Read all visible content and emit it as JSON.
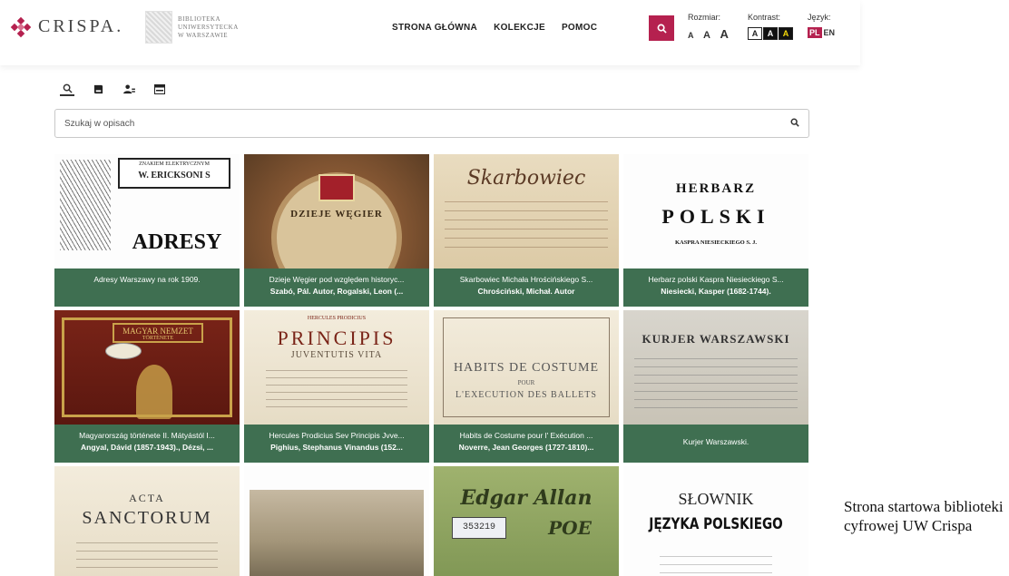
{
  "header": {
    "logo_text": "CRISPA.",
    "uw_logo_lines": [
      "BIBLIOTEKA",
      "UNIWERSYTECKA",
      "W WARSZAWIE"
    ],
    "nav": [
      "STRONA GŁÓWNA",
      "KOLEKCJE",
      "POMOC"
    ],
    "size_label": "Rozmiar:",
    "size_options": [
      "A",
      "A",
      "A"
    ],
    "contrast_label": "Kontrast:",
    "contrast_options": [
      "A",
      "A",
      "A"
    ],
    "lang_label": "Język:",
    "lang_active": "PL",
    "lang_other": "EN",
    "accent_color": "#b5214f"
  },
  "search": {
    "placeholder": "Szukaj w opisach",
    "tab_icons": [
      "search-icon",
      "book-icon",
      "person-icon",
      "card-icon"
    ]
  },
  "grid": [
    {
      "thumb_texts": [
        "ZNAKIEM ELEKTRYCZNYM",
        "W. ERICKSONI S",
        "ADRESY"
      ],
      "title": "Adresy Warszawy na rok 1909.",
      "author": ""
    },
    {
      "thumb_texts": [
        "DZIEJE WĘGIER"
      ],
      "title": "Dzieje Węgier pod względem historyc...",
      "author": "Szabó, Pál. Autor, Rogalski, Leon (..."
    },
    {
      "thumb_texts": [
        "Skarbowiec"
      ],
      "title": "Skarbowiec Michała Hrościńskiego S...",
      "author": "Chrościński, Michał. Autor"
    },
    {
      "thumb_texts": [
        "HERBARZ",
        "POLSKI",
        "KASPRA NIESIECKIEGO S. J."
      ],
      "title": "Herbarz polski Kaspra Niesieckiego S...",
      "author": "Niesiecki, Kasper (1682-1744)."
    },
    {
      "thumb_texts": [
        "MAGYAR NEMZET",
        "TÖRTÉNETE"
      ],
      "title": "Magyarország története II. Mátyástól I...",
      "author": "Angyal, Dávid (1857-1943)., Dézsi, ..."
    },
    {
      "thumb_texts": [
        "HERCULES PRODICIUS",
        "PRINCIPIS",
        "JUVENTUTIS VITA"
      ],
      "title": "Hercules Prodicius Sev Principis Jvve...",
      "author": "Pighius, Stephanus Vinandus (152..."
    },
    {
      "thumb_texts": [
        "HABITS DE COSTUME",
        "POUR",
        "L'EXECUTION DES BALLETS"
      ],
      "title": "Habits de Costume pour l' Exécution ...",
      "author": "Noverre, Jean Georges (1727-1810)..."
    },
    {
      "thumb_texts": [
        "KURJER WARSZAWSKI"
      ],
      "title": "Kurjer Warszawski.",
      "author": ""
    },
    {
      "thumb_texts": [
        "ACTA",
        "SANCTORUM"
      ],
      "title": "",
      "author": ""
    },
    {
      "thumb_texts": [],
      "title": "",
      "author": ""
    },
    {
      "thumb_texts": [
        "Edgar Allan",
        "POE",
        "353219"
      ],
      "title": "",
      "author": ""
    },
    {
      "thumb_texts": [
        "SŁOWNIK",
        "JĘZYKA POLSKIEGO"
      ],
      "title": "",
      "author": ""
    }
  ],
  "side_caption": "Strona startowa biblioteki cyfrowej UW Crispa"
}
